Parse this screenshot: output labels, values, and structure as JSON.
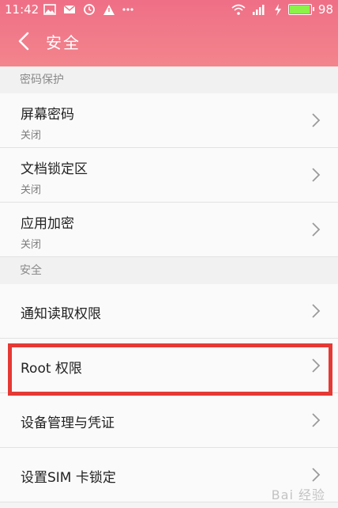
{
  "status_bar": {
    "time": "11:42",
    "battery_level": "98",
    "battery_fraction": 0.98,
    "icons_left": [
      "image-icon",
      "mail-icon",
      "alarm-icon",
      "warning-icon",
      "more-icon"
    ],
    "icons_right": [
      "wifi-icon",
      "signal-icon",
      "charging-icon",
      "battery-icon"
    ]
  },
  "header": {
    "title": "安全",
    "gradient_colors": [
      "#ef6f86",
      "#f3848c"
    ]
  },
  "sections": [
    {
      "header": "密码保护",
      "rows": [
        {
          "title": "屏幕密码",
          "subtitle": "关闭"
        },
        {
          "title": "文档锁定区",
          "subtitle": "关闭"
        },
        {
          "title": "应用加密",
          "subtitle": "关闭"
        }
      ]
    },
    {
      "header": "安全",
      "rows": [
        {
          "title": "通知读取权限"
        },
        {
          "title": "Root 权限"
        },
        {
          "title": "设备管理与凭证"
        },
        {
          "title": "设置SIM 卡锁定"
        }
      ]
    }
  ],
  "highlight": {
    "target": "Root 权限",
    "color": "#e53935"
  },
  "watermark": "Bai 经验"
}
